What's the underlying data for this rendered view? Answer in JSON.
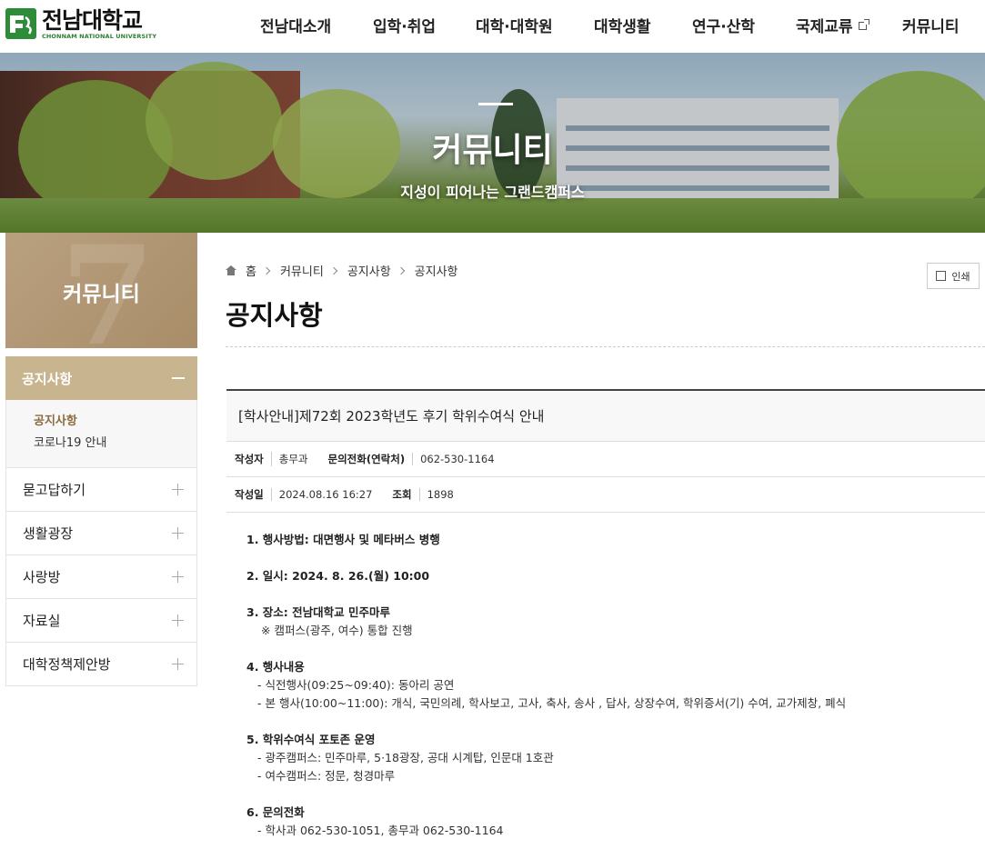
{
  "logo": {
    "name": "전남대학교",
    "english": "CHONNAM NATIONAL UNIVERSITY"
  },
  "gnb": [
    {
      "label": "전남대소개"
    },
    {
      "label": "입학·취업"
    },
    {
      "label": "대학·대학원"
    },
    {
      "label": "대학생활"
    },
    {
      "label": "연구·산학"
    },
    {
      "label": "국제교류"
    },
    {
      "label": "커뮤니티"
    }
  ],
  "banner": {
    "title": "커뮤니티",
    "subtitle": "지성이 피어나는 그랜드캠퍼스"
  },
  "sidebar": {
    "title": "커뮤니티",
    "active": {
      "label": "공지사항"
    },
    "sub": [
      {
        "label": "공지사항"
      },
      {
        "label": "코로나19 안내"
      }
    ],
    "items": [
      {
        "label": "묻고답하기"
      },
      {
        "label": "생활광장"
      },
      {
        "label": "사랑방"
      },
      {
        "label": "자료실"
      },
      {
        "label": "대학정책제안방"
      }
    ]
  },
  "breadcrumb": [
    "홈",
    "커뮤니티",
    "공지사항",
    "공지사항"
  ],
  "print_label": "인쇄",
  "page_title": "공지사항",
  "post": {
    "title": "[학사안내]제72회 2023학년도 후기 학위수여식 안내",
    "meta": {
      "author_label": "작성자",
      "author": "총무과",
      "contact_label": "문의전화(연락처)",
      "contact": "062-530-1164",
      "date_label": "작성일",
      "date": "2024.08.16 16:27",
      "views_label": "조회",
      "views": "1898"
    },
    "body": {
      "s1": "1. 행사방법: 대면행사 및 메타버스 병행",
      "s2": "2. 일시: 2024. 8. 26.(월) 10:00",
      "s3": "3. 장소: 전남대학교 민주마루",
      "s3a": "※ 캠퍼스(광주, 여수) 통합 진행",
      "s4": "4. 행사내용",
      "s4a": "- 식전행사(09:25~09:40): 동아리 공연",
      "s4b": "- 본 행사(10:00~11:00): 개식, 국민의례, 학사보고, 고사, 축사, 송사 , 답사, 상장수여, 학위증서(기) 수여, 교가제창, 폐식",
      "s5": "5. 학위수여식 포토존 운영",
      "s5a": "- 광주캠퍼스: 민주마루, 5·18광장, 공대 시계탑, 인문대 1호관",
      "s5b": "- 여수캠퍼스: 정문, 청경마루",
      "s6": "6. 문의전화",
      "s6a": "- 학사과 062-530-1051, 총무과 062-530-1164"
    }
  }
}
